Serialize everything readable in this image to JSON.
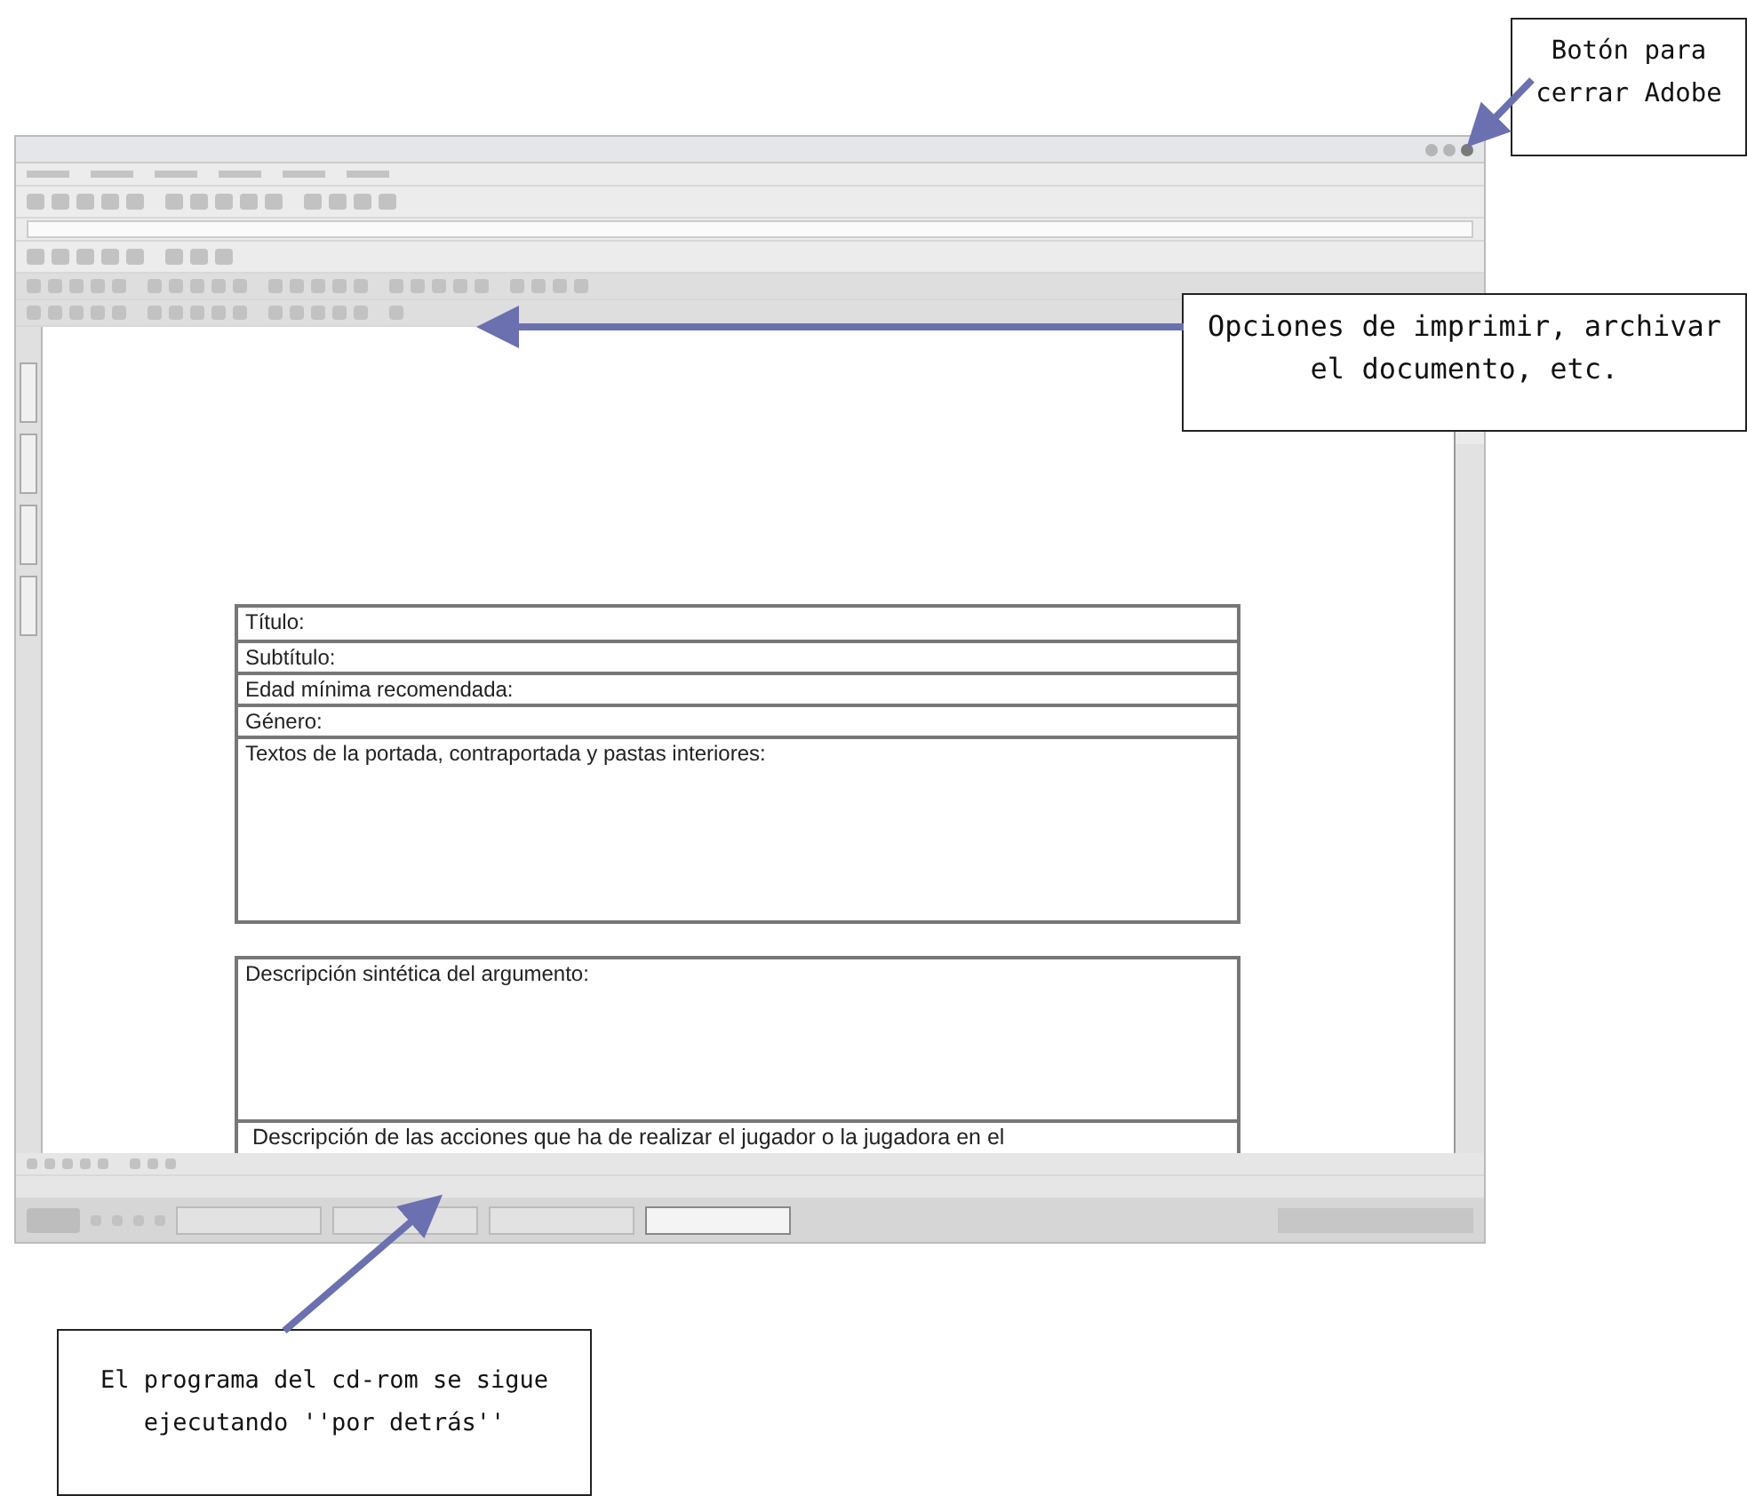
{
  "window": {
    "document": {
      "field_groups": [
        {
          "fields": [
            {
              "label": "Título:",
              "kind": "line"
            },
            {
              "label": "Subtítulo:",
              "kind": "line"
            },
            {
              "label": "Edad mínima recomendada:",
              "kind": "line"
            },
            {
              "label": "Género:",
              "kind": "line"
            },
            {
              "label": "Textos de la portada, contraportada y pastas interiores:",
              "kind": "area"
            }
          ]
        },
        {
          "fields": [
            {
              "label": "Descripción sintética del argumento:",
              "kind": "area"
            },
            {
              "label": "Descripción de las acciones que ha de realizar el jugador o la jugadora en el",
              "kind": "cut"
            }
          ]
        }
      ]
    }
  },
  "callouts": [
    {
      "text": "Botón para cerrar Adobe"
    },
    {
      "text": "Opciones de imprimir, archivar el documento, etc."
    },
    {
      "text": "El programa del cd-rom se sigue ejecutando ''por detrás''"
    }
  ]
}
